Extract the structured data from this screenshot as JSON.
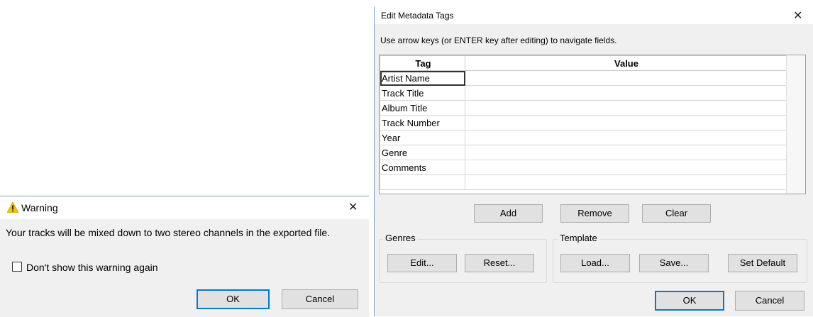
{
  "warning_dialog": {
    "title": "Warning",
    "message": "Your tracks will be mixed down to two stereo channels in the exported file.",
    "checkbox_label": "Don't show this warning again",
    "ok_label": "OK",
    "cancel_label": "Cancel"
  },
  "metadata_dialog": {
    "title": "Edit Metadata Tags",
    "instructions": "Use arrow keys (or ENTER key after editing) to navigate fields.",
    "columns": {
      "tag": "Tag",
      "value": "Value"
    },
    "rows": [
      {
        "tag": "Artist Name",
        "value": ""
      },
      {
        "tag": "Track Title",
        "value": ""
      },
      {
        "tag": "Album Title",
        "value": ""
      },
      {
        "tag": "Track Number",
        "value": ""
      },
      {
        "tag": "Year",
        "value": ""
      },
      {
        "tag": "Genre",
        "value": ""
      },
      {
        "tag": "Comments",
        "value": ""
      },
      {
        "tag": "",
        "value": ""
      }
    ],
    "buttons": {
      "add": "Add",
      "remove": "Remove",
      "clear": "Clear"
    },
    "genres": {
      "label": "Genres",
      "edit": "Edit...",
      "reset": "Reset..."
    },
    "template": {
      "label": "Template",
      "load": "Load...",
      "save": "Save...",
      "set_default": "Set Default"
    },
    "ok_label": "OK",
    "cancel_label": "Cancel"
  }
}
